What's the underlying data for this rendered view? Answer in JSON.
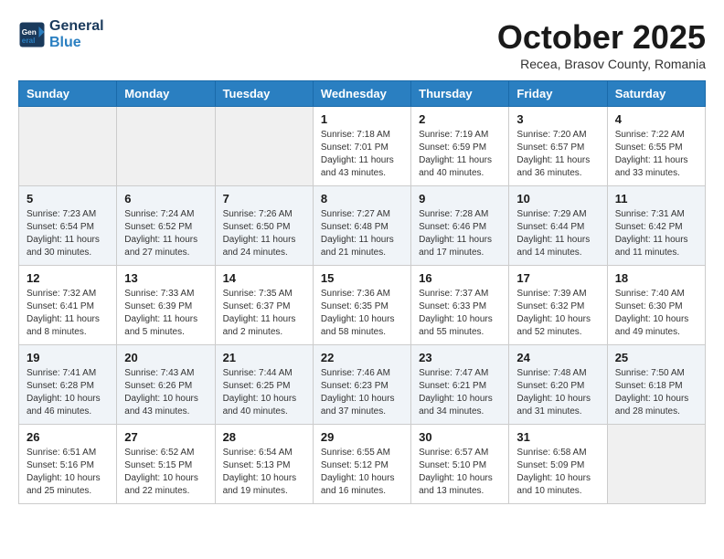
{
  "header": {
    "logo_line1": "General",
    "logo_line2": "Blue",
    "month": "October 2025",
    "location": "Recea, Brasov County, Romania"
  },
  "days_of_week": [
    "Sunday",
    "Monday",
    "Tuesday",
    "Wednesday",
    "Thursday",
    "Friday",
    "Saturday"
  ],
  "weeks": [
    [
      {
        "day": "",
        "info": ""
      },
      {
        "day": "",
        "info": ""
      },
      {
        "day": "",
        "info": ""
      },
      {
        "day": "1",
        "info": "Sunrise: 7:18 AM\nSunset: 7:01 PM\nDaylight: 11 hours\nand 43 minutes."
      },
      {
        "day": "2",
        "info": "Sunrise: 7:19 AM\nSunset: 6:59 PM\nDaylight: 11 hours\nand 40 minutes."
      },
      {
        "day": "3",
        "info": "Sunrise: 7:20 AM\nSunset: 6:57 PM\nDaylight: 11 hours\nand 36 minutes."
      },
      {
        "day": "4",
        "info": "Sunrise: 7:22 AM\nSunset: 6:55 PM\nDaylight: 11 hours\nand 33 minutes."
      }
    ],
    [
      {
        "day": "5",
        "info": "Sunrise: 7:23 AM\nSunset: 6:54 PM\nDaylight: 11 hours\nand 30 minutes."
      },
      {
        "day": "6",
        "info": "Sunrise: 7:24 AM\nSunset: 6:52 PM\nDaylight: 11 hours\nand 27 minutes."
      },
      {
        "day": "7",
        "info": "Sunrise: 7:26 AM\nSunset: 6:50 PM\nDaylight: 11 hours\nand 24 minutes."
      },
      {
        "day": "8",
        "info": "Sunrise: 7:27 AM\nSunset: 6:48 PM\nDaylight: 11 hours\nand 21 minutes."
      },
      {
        "day": "9",
        "info": "Sunrise: 7:28 AM\nSunset: 6:46 PM\nDaylight: 11 hours\nand 17 minutes."
      },
      {
        "day": "10",
        "info": "Sunrise: 7:29 AM\nSunset: 6:44 PM\nDaylight: 11 hours\nand 14 minutes."
      },
      {
        "day": "11",
        "info": "Sunrise: 7:31 AM\nSunset: 6:42 PM\nDaylight: 11 hours\nand 11 minutes."
      }
    ],
    [
      {
        "day": "12",
        "info": "Sunrise: 7:32 AM\nSunset: 6:41 PM\nDaylight: 11 hours\nand 8 minutes."
      },
      {
        "day": "13",
        "info": "Sunrise: 7:33 AM\nSunset: 6:39 PM\nDaylight: 11 hours\nand 5 minutes."
      },
      {
        "day": "14",
        "info": "Sunrise: 7:35 AM\nSunset: 6:37 PM\nDaylight: 11 hours\nand 2 minutes."
      },
      {
        "day": "15",
        "info": "Sunrise: 7:36 AM\nSunset: 6:35 PM\nDaylight: 10 hours\nand 58 minutes."
      },
      {
        "day": "16",
        "info": "Sunrise: 7:37 AM\nSunset: 6:33 PM\nDaylight: 10 hours\nand 55 minutes."
      },
      {
        "day": "17",
        "info": "Sunrise: 7:39 AM\nSunset: 6:32 PM\nDaylight: 10 hours\nand 52 minutes."
      },
      {
        "day": "18",
        "info": "Sunrise: 7:40 AM\nSunset: 6:30 PM\nDaylight: 10 hours\nand 49 minutes."
      }
    ],
    [
      {
        "day": "19",
        "info": "Sunrise: 7:41 AM\nSunset: 6:28 PM\nDaylight: 10 hours\nand 46 minutes."
      },
      {
        "day": "20",
        "info": "Sunrise: 7:43 AM\nSunset: 6:26 PM\nDaylight: 10 hours\nand 43 minutes."
      },
      {
        "day": "21",
        "info": "Sunrise: 7:44 AM\nSunset: 6:25 PM\nDaylight: 10 hours\nand 40 minutes."
      },
      {
        "day": "22",
        "info": "Sunrise: 7:46 AM\nSunset: 6:23 PM\nDaylight: 10 hours\nand 37 minutes."
      },
      {
        "day": "23",
        "info": "Sunrise: 7:47 AM\nSunset: 6:21 PM\nDaylight: 10 hours\nand 34 minutes."
      },
      {
        "day": "24",
        "info": "Sunrise: 7:48 AM\nSunset: 6:20 PM\nDaylight: 10 hours\nand 31 minutes."
      },
      {
        "day": "25",
        "info": "Sunrise: 7:50 AM\nSunset: 6:18 PM\nDaylight: 10 hours\nand 28 minutes."
      }
    ],
    [
      {
        "day": "26",
        "info": "Sunrise: 6:51 AM\nSunset: 5:16 PM\nDaylight: 10 hours\nand 25 minutes."
      },
      {
        "day": "27",
        "info": "Sunrise: 6:52 AM\nSunset: 5:15 PM\nDaylight: 10 hours\nand 22 minutes."
      },
      {
        "day": "28",
        "info": "Sunrise: 6:54 AM\nSunset: 5:13 PM\nDaylight: 10 hours\nand 19 minutes."
      },
      {
        "day": "29",
        "info": "Sunrise: 6:55 AM\nSunset: 5:12 PM\nDaylight: 10 hours\nand 16 minutes."
      },
      {
        "day": "30",
        "info": "Sunrise: 6:57 AM\nSunset: 5:10 PM\nDaylight: 10 hours\nand 13 minutes."
      },
      {
        "day": "31",
        "info": "Sunrise: 6:58 AM\nSunset: 5:09 PM\nDaylight: 10 hours\nand 10 minutes."
      },
      {
        "day": "",
        "info": ""
      }
    ]
  ]
}
